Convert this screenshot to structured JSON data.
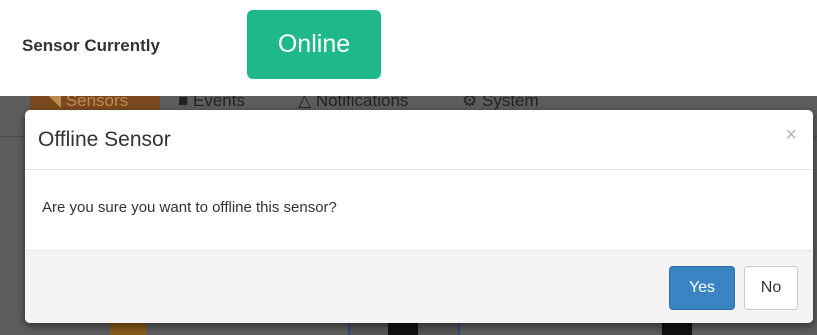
{
  "status": {
    "label": "Sensor Currently",
    "badge": "Online",
    "badge_color": "#1fb889"
  },
  "background_nav": {
    "tabs": [
      {
        "label": "Sensors",
        "icon": "signal-icon"
      },
      {
        "label": "Events",
        "icon": "book-icon"
      },
      {
        "label": "Notifications",
        "icon": "bell-icon"
      },
      {
        "label": "System",
        "icon": "gears-icon"
      }
    ]
  },
  "modal": {
    "title": "Offline Sensor",
    "close_symbol": "×",
    "message": "Are you sure you want to offline this sensor?",
    "yes_label": "Yes",
    "no_label": "No",
    "primary_color": "#3a84c4"
  }
}
